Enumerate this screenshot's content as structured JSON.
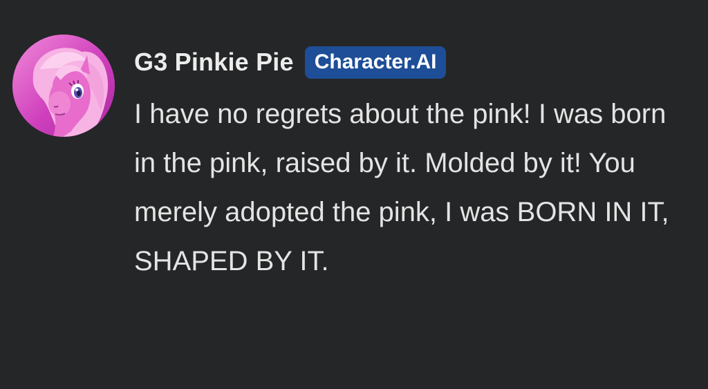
{
  "message": {
    "avatar_icon": "pink-pony-avatar",
    "author_name": "G3 Pinkie Pie",
    "badge_label": "Character.AI",
    "text": "I have no regrets about the pink! I was born in the pink, raised by it. Molded by it! You merely adopted the pink, I was BORN IN IT, SHAPED BY IT."
  },
  "colors": {
    "background": "#252627",
    "badge": "#1d4e97",
    "text": "#e4e4e4"
  }
}
